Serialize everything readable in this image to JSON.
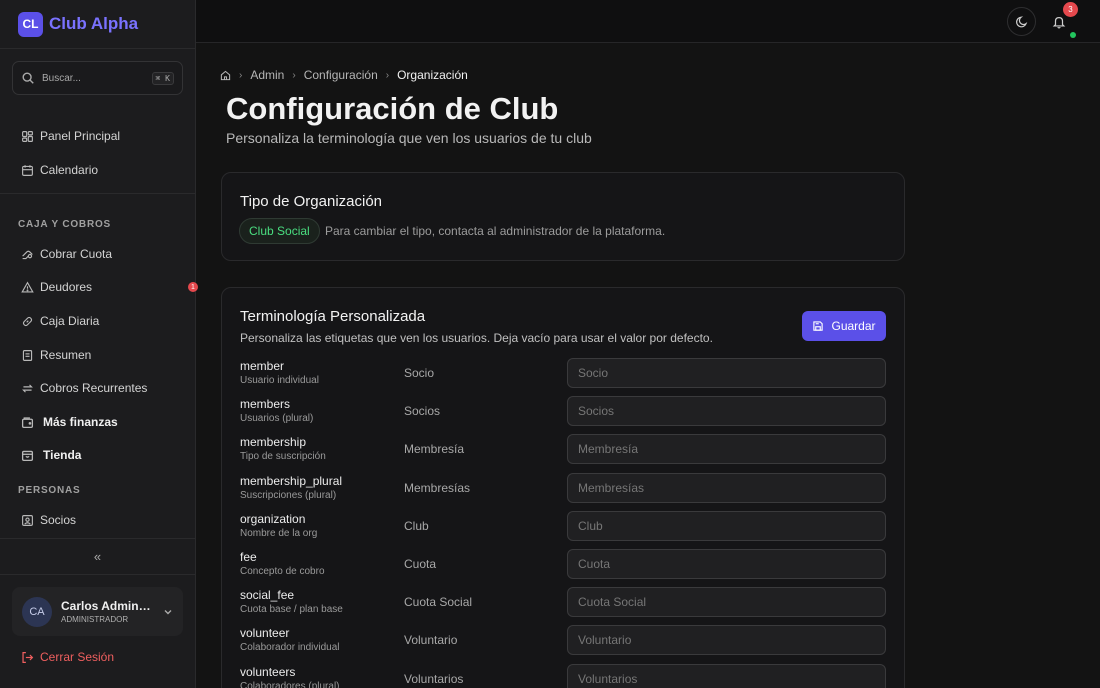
{
  "brand": {
    "logo": "CL",
    "name": "Club Alpha"
  },
  "search": {
    "placeholder": "Buscar...",
    "shortcut": "⌘ K"
  },
  "nav_top": [
    {
      "label": "Panel Principal",
      "icon": "dashboard-icon"
    },
    {
      "label": "Calendario",
      "icon": "calendar-icon"
    }
  ],
  "section_finance": "CAJA Y COBROS",
  "nav_finance": [
    {
      "label": "Cobrar Cuota",
      "icon": "coins-icon"
    },
    {
      "label": "Deudores",
      "icon": "alert-triangle-icon"
    },
    {
      "label": "Caja Diaria",
      "icon": "link-icon"
    },
    {
      "label": "Resumen",
      "icon": "receipt-icon"
    },
    {
      "label": "Cobros Recurrentes",
      "icon": "repeat-icon"
    },
    {
      "label": "Más finanzas",
      "icon": "wallet-icon"
    },
    {
      "label": "Tienda",
      "icon": "store-icon"
    }
  ],
  "deudores_badge": "1",
  "section_people": "PERSONAS",
  "nav_people": [
    {
      "label": "Socios",
      "icon": "id-card-icon"
    }
  ],
  "collapse_glyph": "«",
  "user": {
    "initials": "CA",
    "name": "Carlos Administrador",
    "role": "ADMINISTRADOR"
  },
  "logout_label": "Cerrar Sesión",
  "notifications_count": "3",
  "breadcrumb": {
    "items": [
      "Admin",
      "Configuración"
    ],
    "current": "Organización"
  },
  "page": {
    "title": "Configuración de Club",
    "subtitle": "Personaliza la terminología que ven los usuarios de tu club"
  },
  "org_card": {
    "title": "Tipo de Organización",
    "type_pill": "Club Social",
    "note": "Para cambiar el tipo, contacta al administrador de la plataforma."
  },
  "terms_card": {
    "title": "Terminología Personalizada",
    "description": "Personaliza las etiquetas que ven los usuarios. Deja vacío para usar el valor por defecto.",
    "save_label": "Guardar",
    "rows": [
      {
        "key": "member",
        "hint": "Usuario individual",
        "default": "Socio",
        "placeholder": "Socio"
      },
      {
        "key": "members",
        "hint": "Usuarios (plural)",
        "default": "Socios",
        "placeholder": "Socios"
      },
      {
        "key": "membership",
        "hint": "Tipo de suscripción",
        "default": "Membresía",
        "placeholder": "Membresía"
      },
      {
        "key": "membership_plural",
        "hint": "Suscripciones (plural)",
        "default": "Membresías",
        "placeholder": "Membresías"
      },
      {
        "key": "organization",
        "hint": "Nombre de la org",
        "default": "Club",
        "placeholder": "Club"
      },
      {
        "key": "fee",
        "hint": "Concepto de cobro",
        "default": "Cuota",
        "placeholder": "Cuota"
      },
      {
        "key": "social_fee",
        "hint": "Cuota base / plan base",
        "default": "Cuota Social",
        "placeholder": "Cuota Social"
      },
      {
        "key": "volunteer",
        "hint": "Colaborador individual",
        "default": "Voluntario",
        "placeholder": "Voluntario"
      },
      {
        "key": "volunteers",
        "hint": "Colaboradores (plural)",
        "default": "Voluntarios",
        "placeholder": "Voluntarios"
      }
    ]
  }
}
